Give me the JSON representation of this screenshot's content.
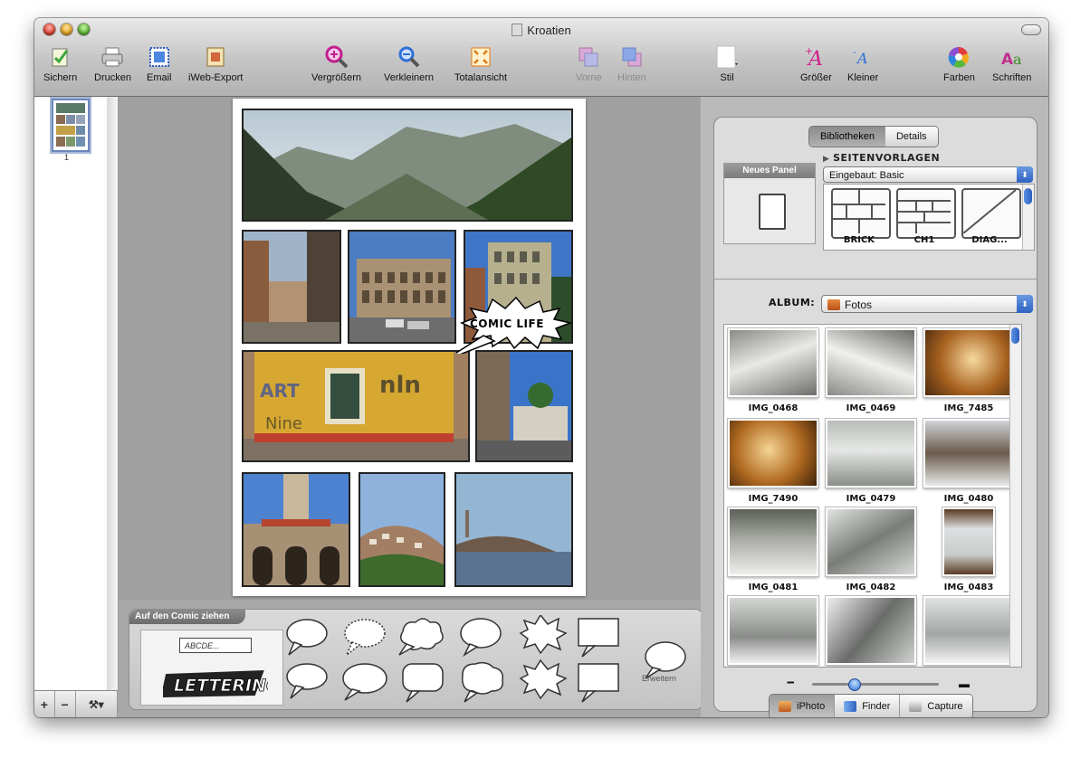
{
  "window": {
    "title": "Kroatien"
  },
  "toolbar": {
    "sichern": "Sichern",
    "drucken": "Drucken",
    "email": "Email",
    "iweb": "iWeb-Export",
    "vergroessern": "Vergrößern",
    "verkleinern": "Verkleinern",
    "totalansicht": "Totalansicht",
    "vorne": "Vorne",
    "hinten": "Hinten",
    "stil": "Stil",
    "groesser": "Größer",
    "kleiner": "Kleiner",
    "farben": "Farben",
    "schriften": "Schriften"
  },
  "sidebar": {
    "page_number": "1",
    "add": "+",
    "remove": "−",
    "tools": "⚒▾"
  },
  "comic": {
    "balloon_text": "COMIC LIFE"
  },
  "tray": {
    "title": "Auf den Comic ziehen",
    "text_placeholder": "ABCDE...",
    "expand": "Erweitern",
    "lettering": "LETTERING"
  },
  "library": {
    "tab_libraries": "Bibliotheken",
    "tab_details": "Details",
    "section": "SEITENVORLAGEN",
    "new_panel": "Neues Panel",
    "template_set": "Eingebaut: Basic",
    "layouts": [
      "BRICK",
      "CH1",
      "DIAG..."
    ],
    "album_label": "ALBUM:",
    "album": "Fotos",
    "photos": [
      "IMG_0468",
      "IMG_0469",
      "IMG_7485",
      "IMG_7490",
      "IMG_0479",
      "IMG_0480",
      "IMG_0481",
      "IMG_0482",
      "IMG_0483"
    ],
    "sources": [
      "iPhoto",
      "Finder",
      "Capture"
    ]
  },
  "colors": {
    "accent": "#2f62c2",
    "window_bg": "#a0a0a0"
  }
}
